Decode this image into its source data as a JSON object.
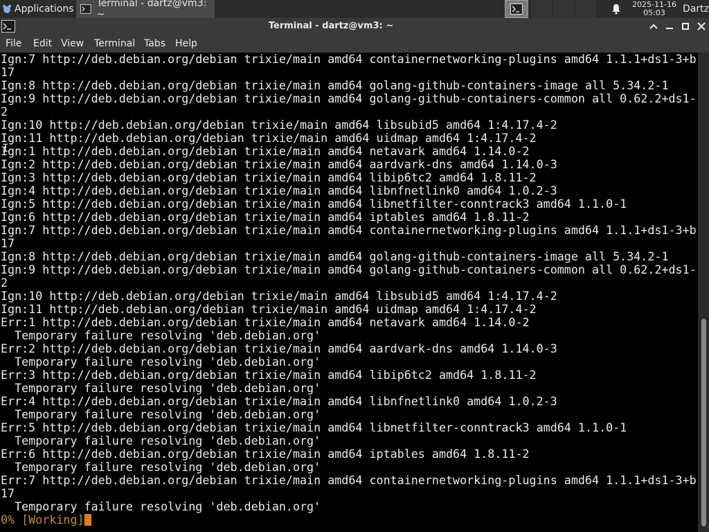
{
  "panel": {
    "apps_label": "Applications",
    "task_label": "Terminal - dartz@vm3: ~",
    "clock_date": "2025-11-16",
    "clock_time": "05:03",
    "user_label": "Dartz"
  },
  "window": {
    "title": "Terminal - dartz@vm3: ~"
  },
  "menu": {
    "file": "File",
    "edit": "Edit",
    "view": "View",
    "terminal": "Terminal",
    "tabs": "Tabs",
    "help": "Help"
  },
  "terminal": {
    "lines": [
      "Ign:7 http://deb.debian.org/debian trixie/main amd64 containernetworking-plugins amd64 1.1.1+ds1-3+b",
      "17",
      "Ign:8 http://deb.debian.org/debian trixie/main amd64 golang-github-containers-image all 5.34.2-1",
      "Ign:9 http://deb.debian.org/debian trixie/main amd64 golang-github-containers-common all 0.62.2+ds1-",
      "2",
      "Ign:10 http://deb.debian.org/debian trixie/main amd64 libsubid5 amd64 1:4.17.4-2",
      "Ign:11 http://deb.debian.org/debian trixie/main amd64 uidmap amd64 1:4.17.4-2",
      "Ign:1 http://deb.debian.org/debian trixie/main amd64 netavark amd64 1.14.0-2",
      "Ign:2 http://deb.debian.org/debian trixie/main amd64 aardvark-dns amd64 1.14.0-3",
      "Ign:3 http://deb.debian.org/debian trixie/main amd64 libip6tc2 amd64 1.8.11-2",
      "Ign:4 http://deb.debian.org/debian trixie/main amd64 libnfnetlink0 amd64 1.0.2-3",
      "Ign:5 http://deb.debian.org/debian trixie/main amd64 libnetfilter-conntrack3 amd64 1.1.0-1",
      "Ign:6 http://deb.debian.org/debian trixie/main amd64 iptables amd64 1.8.11-2",
      "Ign:7 http://deb.debian.org/debian trixie/main amd64 containernetworking-plugins amd64 1.1.1+ds1-3+b",
      "17",
      "Ign:8 http://deb.debian.org/debian trixie/main amd64 golang-github-containers-image all 5.34.2-1",
      "Ign:9 http://deb.debian.org/debian trixie/main amd64 golang-github-containers-common all 0.62.2+ds1-",
      "2",
      "Ign:10 http://deb.debian.org/debian trixie/main amd64 libsubid5 amd64 1:4.17.4-2",
      "Ign:11 http://deb.debian.org/debian trixie/main amd64 uidmap amd64 1:4.17.4-2",
      "Err:1 http://deb.debian.org/debian trixie/main amd64 netavark amd64 1.14.0-2",
      "  Temporary failure resolving 'deb.debian.org'",
      "Err:2 http://deb.debian.org/debian trixie/main amd64 aardvark-dns amd64 1.14.0-3",
      "  Temporary failure resolving 'deb.debian.org'",
      "Err:3 http://deb.debian.org/debian trixie/main amd64 libip6tc2 amd64 1.8.11-2",
      "  Temporary failure resolving 'deb.debian.org'",
      "Err:4 http://deb.debian.org/debian trixie/main amd64 libnfnetlink0 amd64 1.0.2-3",
      "  Temporary failure resolving 'deb.debian.org'",
      "Err:5 http://deb.debian.org/debian trixie/main amd64 libnetfilter-conntrack3 amd64 1.1.0-1",
      "  Temporary failure resolving 'deb.debian.org'",
      "Err:6 http://deb.debian.org/debian trixie/main amd64 iptables amd64 1.8.11-2",
      "  Temporary failure resolving 'deb.debian.org'",
      "Err:7 http://deb.debian.org/debian trixie/main amd64 containernetworking-plugins amd64 1.1.1+ds1-3+b",
      "17",
      "  Temporary failure resolving 'deb.debian.org'"
    ],
    "status_line": "0% [Working]"
  },
  "icons": {
    "apps": "xfce-mouse-icon",
    "terminal": "terminal-icon",
    "bell": "bell-icon"
  },
  "colors": {
    "panel_bg": "#2b2b2b",
    "titlebar_bg": "#3a3a3a",
    "terminal_bg": "#000000",
    "terminal_fg": "#ececec",
    "status_fg": "#c98a3a",
    "cursor": "#e07a20"
  }
}
